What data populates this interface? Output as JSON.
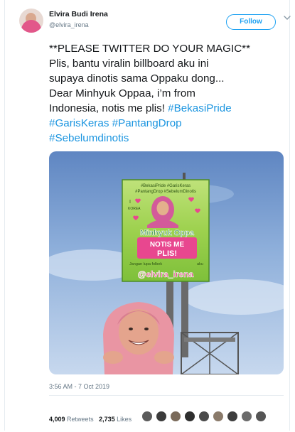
{
  "user": {
    "name": "Elvira Budi Irena",
    "handle": "@elvira_irena",
    "follow_label": "Follow"
  },
  "tweet": {
    "line1": "**PLEASE TWITTER DO YOUR MAGIC**",
    "line2": "Plis, bantu viralin billboard aku ini",
    "line3": "supaya dinotis sama Oppaku dong...",
    "line4": "Dear Minhyuk Oppaa, i’m from",
    "line5_text": "Indonesia, notis me plis! ",
    "hashtags": [
      "#BekasiPride",
      "#GarisKeras",
      "#PantangDrop",
      "#Sebelumdinotis"
    ]
  },
  "billboard": {
    "top_tags_1": "#BekasiPride  #GarisKeras",
    "top_tags_2": "#PantangDrop  #SebelumDinotis",
    "i_love": "I",
    "korea": "KOREA",
    "headline": "Minhyuk Oppa",
    "notis": "NOTIS ME",
    "plis": "PLIS!",
    "jangan": "Jangan lupa folbek",
    "aku": "aku",
    "handle": "@elvira_irena"
  },
  "meta": {
    "timestamp": "3:56 AM - 7 Oct 2019",
    "retweets_count": "4,009",
    "retweets_label": "Retweets",
    "likes_count": "2,735",
    "likes_label": "Likes"
  },
  "colors": {
    "accent": "#1da1f2",
    "hashtag": "#1b95e0",
    "muted": "#657786",
    "billboard_green": "#5fae2e",
    "billboard_pink": "#e8478f"
  },
  "likers": [
    "avatar-1",
    "avatar-2",
    "avatar-3",
    "avatar-4",
    "avatar-5",
    "avatar-6",
    "avatar-7",
    "avatar-8",
    "avatar-9"
  ]
}
